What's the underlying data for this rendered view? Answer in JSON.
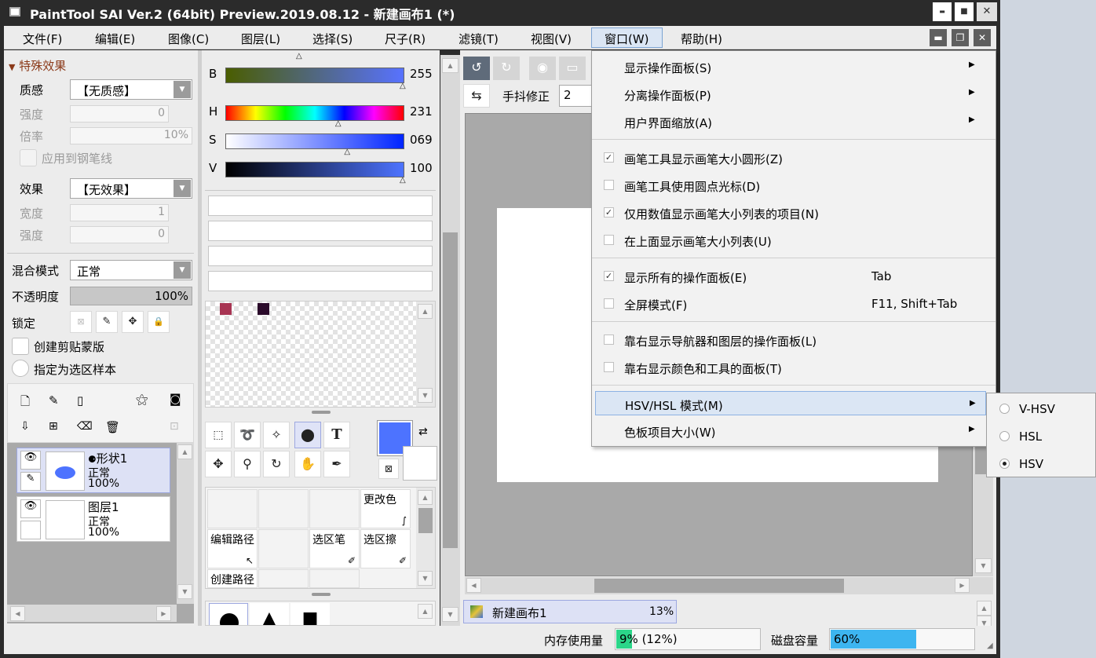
{
  "window": {
    "title": "PaintTool SAI Ver.2 (64bit) Preview.2019.08.12 - 新建画布1 (*)",
    "minimize": "▬",
    "maximize": "■",
    "close": "✕"
  },
  "menubar": [
    {
      "label": "文件(F)"
    },
    {
      "label": "编辑(E)"
    },
    {
      "label": "图像(C)"
    },
    {
      "label": "图层(L)"
    },
    {
      "label": "选择(S)"
    },
    {
      "label": "尺子(R)"
    },
    {
      "label": "滤镜(T)"
    },
    {
      "label": "视图(V)"
    },
    {
      "label": "窗口(W)"
    },
    {
      "label": "帮助(H)"
    }
  ],
  "effects_panel": {
    "header": "特殊效果",
    "texture_label": "质感",
    "texture_value": "【无质感】",
    "strength_label": "强度",
    "strength_value": "0",
    "scale_label": "倍率",
    "scale_value": "10%",
    "apply_pen_label": "应用到钢笔线",
    "effect_label": "效果",
    "effect_value": "【无效果】",
    "width_label": "宽度",
    "width_value": "1",
    "strength2_label": "强度",
    "strength2_value": "0"
  },
  "layer_props": {
    "blend_label": "混合模式",
    "blend_value": "正常",
    "opacity_label": "不透明度",
    "opacity_value": "100%",
    "opacity_level": 1.0,
    "lock_label": "锁定",
    "clip_label": "创建剪贴蒙版",
    "sample_label": "指定为选区样本"
  },
  "layers": [
    {
      "name": "形状1",
      "mode": "正常",
      "opacity": "100%"
    },
    {
      "name": "图层1",
      "mode": "正常",
      "opacity": "100%"
    }
  ],
  "color_sliders": [
    {
      "label": "B",
      "value": "255",
      "level": 1.0
    },
    {
      "label": "H",
      "value": "231",
      "level": 0.64
    },
    {
      "label": "S",
      "value": "069",
      "level": 0.69
    },
    {
      "label": "V",
      "value": "100",
      "level": 1.0
    }
  ],
  "swatches": {
    "color1": "#a83553",
    "color2": "#2a0a2a"
  },
  "primary_color": "#4d73ff",
  "tool_cells": {
    "recolor": "更改色",
    "edit_path": "编辑路径",
    "sel_pen": "选区笔",
    "sel_eraser": "选区擦",
    "create_path": "创建路径"
  },
  "toolbar2": {
    "stabilizer_label": "手抖修正",
    "stabilizer_value": "2"
  },
  "navigator": {
    "canvas_name": "新建画布1",
    "zoom": "13%"
  },
  "status": {
    "memory_label": "内存使用量",
    "memory_value": "9% (12%)",
    "memory_level": 0.09,
    "disk_label": "磁盘容量",
    "disk_value": "60%",
    "disk_level": 0.6
  },
  "window_menu": {
    "items": [
      {
        "label": "显示操作面板(S)",
        "submenu": true
      },
      {
        "label": "分离操作面板(P)",
        "submenu": true
      },
      {
        "label": "用户界面缩放(A)",
        "submenu": true
      },
      {
        "label": "画笔工具显示画笔大小圆形(Z)",
        "checked": true
      },
      {
        "label": "画笔工具使用圆点光标(D)",
        "checked": false
      },
      {
        "label": "仅用数值显示画笔大小列表的项目(N)",
        "checked": true
      },
      {
        "label": "在上面显示画笔大小列表(U)",
        "checked": false
      },
      {
        "label": "显示所有的操作面板(E)",
        "checked": true,
        "shortcut": "Tab"
      },
      {
        "label": "全屏模式(F)",
        "checked": false,
        "shortcut": "F11, Shift+Tab"
      },
      {
        "label": "靠右显示导航器和图层的操作面板(L)",
        "checked": false
      },
      {
        "label": "靠右显示颜色和工具的面板(T)",
        "checked": false
      },
      {
        "label": "HSV/HSL 模式(M)",
        "submenu": true,
        "highlighted": true
      },
      {
        "label": "色板项目大小(W)",
        "submenu": true
      }
    ]
  },
  "hsv_submenu": [
    {
      "label": "V-HSV",
      "selected": false
    },
    {
      "label": "HSL",
      "selected": false
    },
    {
      "label": "HSV",
      "selected": true
    }
  ],
  "icons": {
    "check": "✓",
    "submenu_arrow": "▶",
    "combo_arrow": "▼"
  }
}
